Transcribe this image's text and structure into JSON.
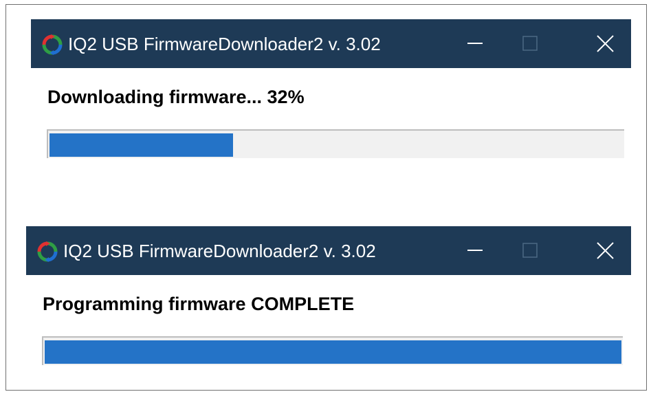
{
  "windows": [
    {
      "title": "IQ2 USB FirmwareDownloader2 v. 3.02",
      "status": "Downloading firmware... 32%",
      "progress_fraction": 0.32
    },
    {
      "title": "IQ2 USB FirmwareDownloader2 v. 3.02",
      "status": "Programming firmware COMPLETE",
      "progress_fraction": 1.0
    }
  ],
  "icons": {
    "app": "refresh-arrows-icon",
    "minimize": "minimize-icon",
    "maximize": "maximize-icon",
    "close": "close-icon"
  },
  "colors": {
    "titlebar": "#1e3a56",
    "progress_fill": "#2473c7",
    "progress_track": "#f1f1f1"
  }
}
